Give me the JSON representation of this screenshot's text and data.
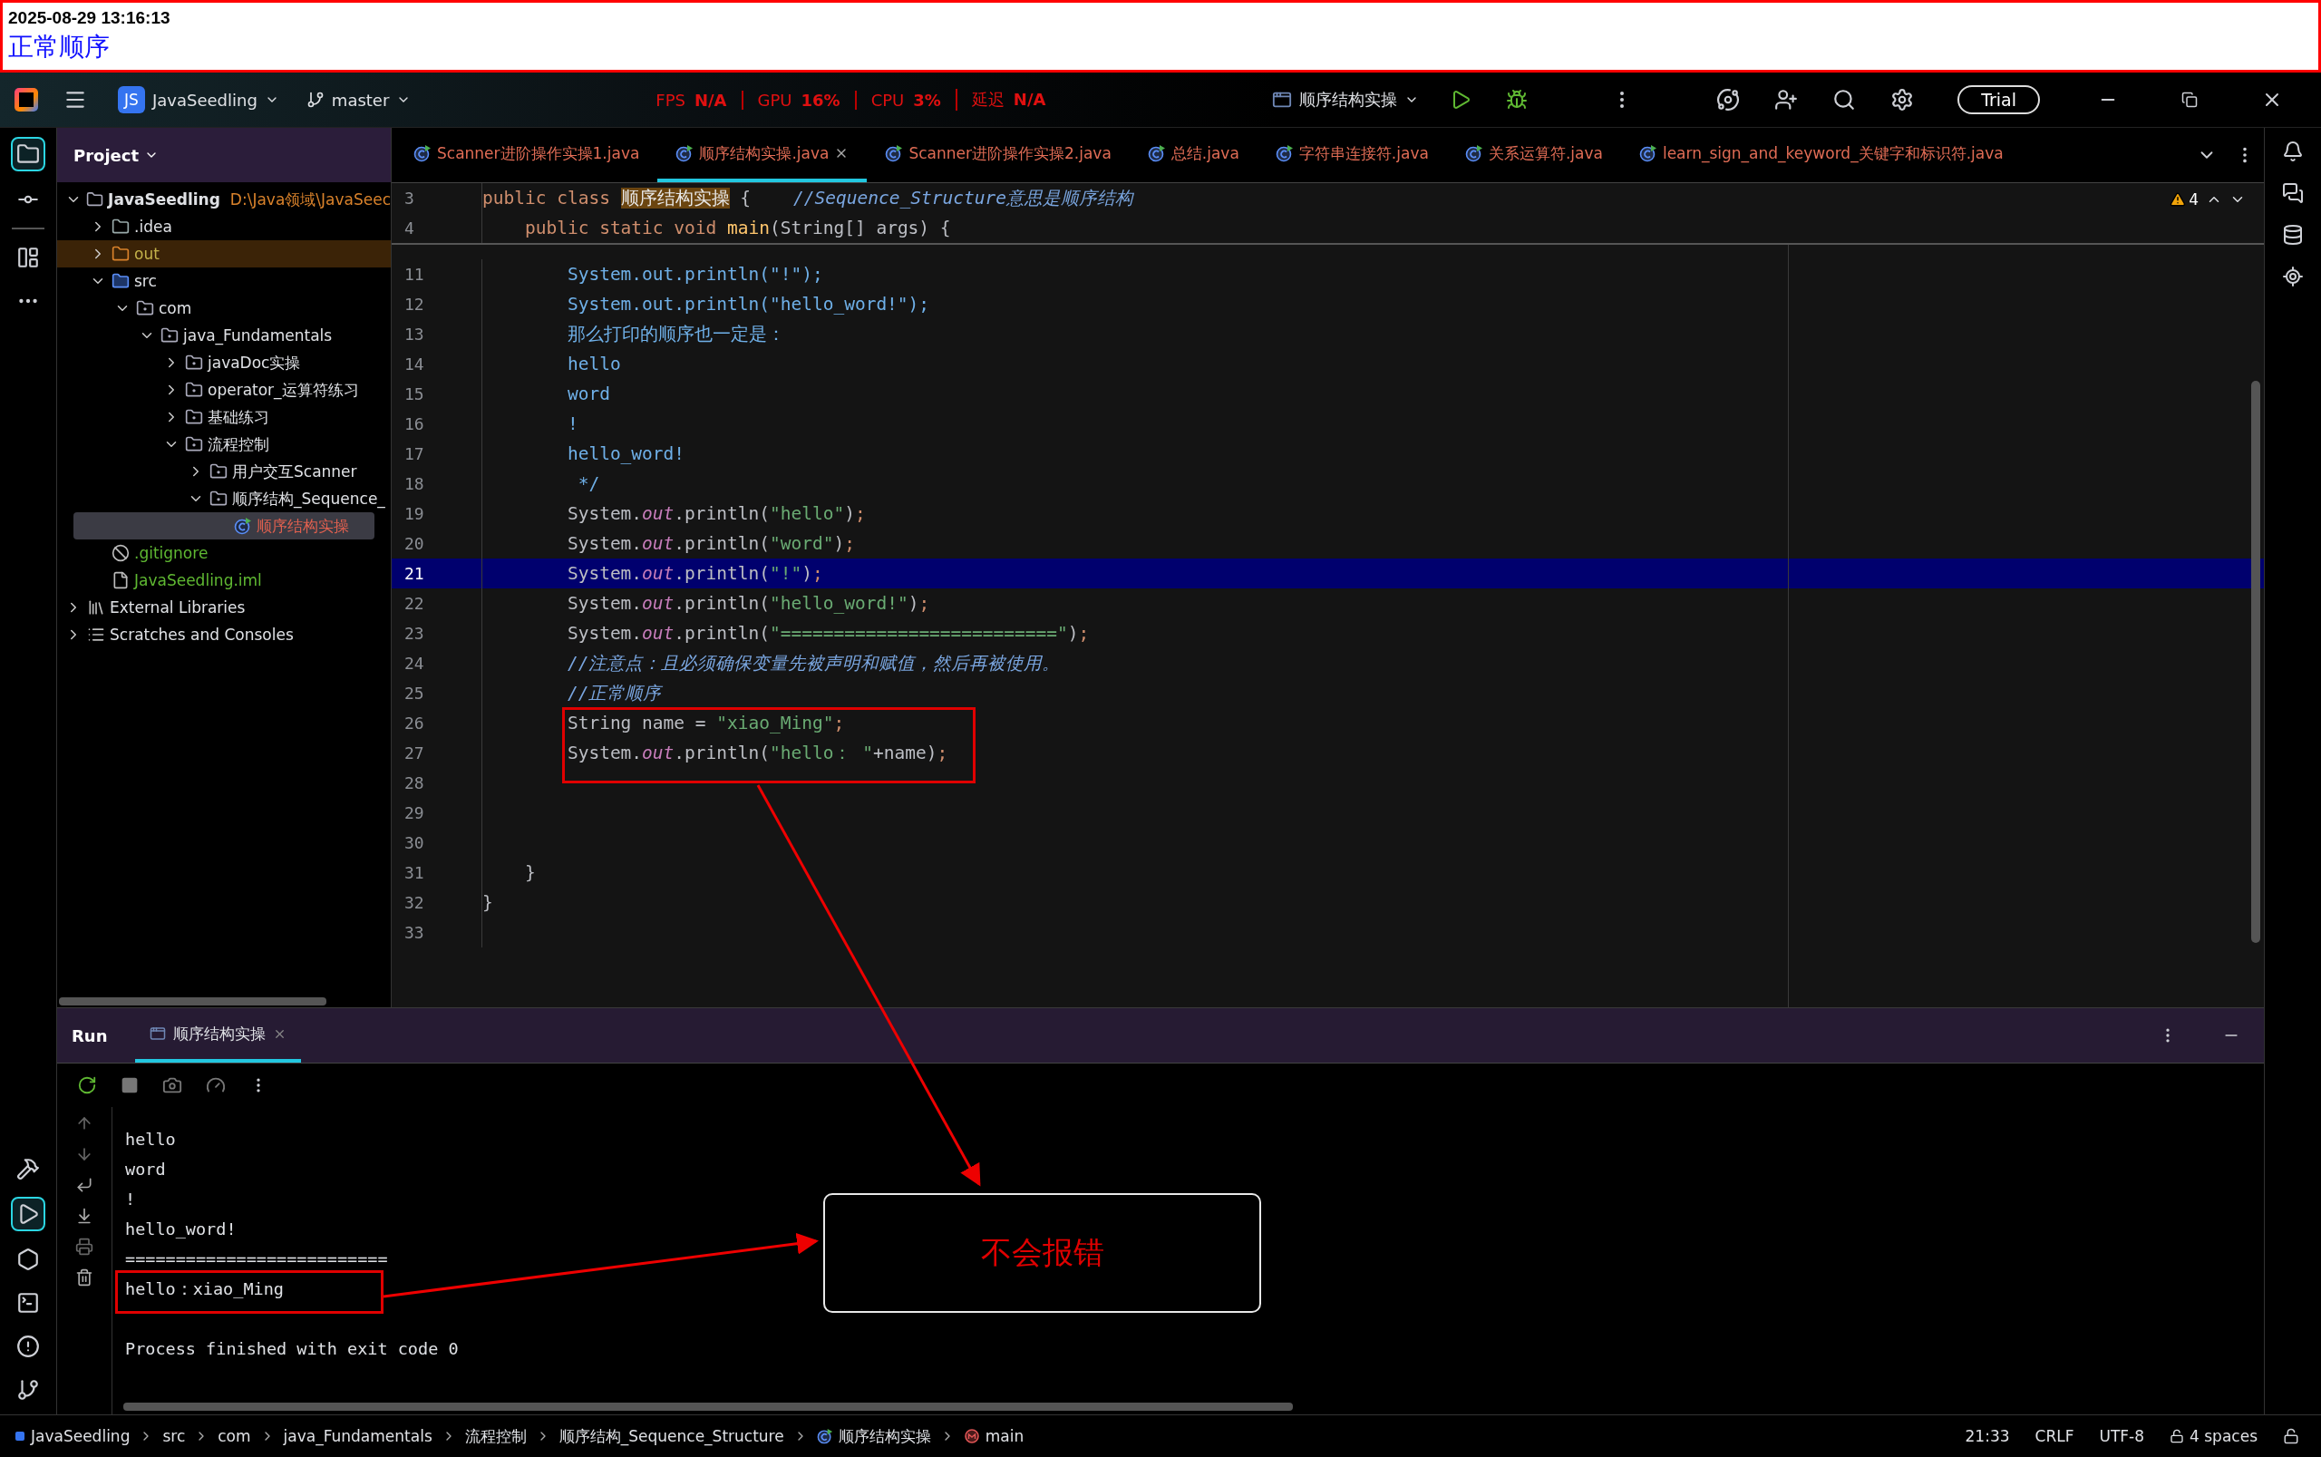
{
  "banner": {
    "timestamp": "2025-08-29 13:16:13",
    "title": "正常顺序"
  },
  "titlebar": {
    "project_badge": "JS",
    "project": "JavaSeedling",
    "branch": "master",
    "metrics": [
      {
        "label": "FPS",
        "value": "N/A"
      },
      {
        "label": "GPU",
        "value": "16%"
      },
      {
        "label": "CPU",
        "value": "3%"
      },
      {
        "label": "延迟",
        "value": "N/A"
      }
    ],
    "run_config": "顺序结构实操",
    "trial": "Trial"
  },
  "project_panel": {
    "title": "Project",
    "tree": [
      {
        "label": "JavaSeedling",
        "path": "D:\\Java领域\\JavaSeec",
        "kind": "module",
        "expanded": true,
        "selected": false,
        "children": [
          {
            "label": ".idea",
            "kind": "folder",
            "expanded": false,
            "selected": false
          },
          {
            "label": "out",
            "kind": "excluded",
            "expanded": false,
            "selected": false
          },
          {
            "label": "src",
            "kind": "source",
            "expanded": true,
            "selected": false,
            "children": [
              {
                "label": "com",
                "kind": "package",
                "expanded": true,
                "selected": false,
                "children": [
                  {
                    "label": "java_Fundamentals",
                    "kind": "package",
                    "expanded": true,
                    "selected": false,
                    "children": [
                      {
                        "label": "javaDoc实操",
                        "kind": "package",
                        "expanded": false,
                        "selected": false
                      },
                      {
                        "label": "operator_运算符练习",
                        "kind": "package",
                        "expanded": false,
                        "selected": false
                      },
                      {
                        "label": "基础练习",
                        "kind": "package",
                        "expanded": false,
                        "selected": false
                      },
                      {
                        "label": "流程控制",
                        "kind": "package",
                        "expanded": true,
                        "selected": false,
                        "children": [
                          {
                            "label": "用户交互Scanner",
                            "kind": "package",
                            "expanded": false,
                            "selected": false
                          },
                          {
                            "label": "顺序结构_Sequence_",
                            "kind": "package",
                            "expanded": true,
                            "selected": false,
                            "children": [
                              {
                                "label": "顺序结构实操",
                                "kind": "class",
                                "selected": true
                              }
                            ]
                          }
                        ]
                      }
                    ]
                  }
                ]
              }
            ]
          },
          {
            "label": ".gitignore",
            "kind": "ignore",
            "selected": false
          },
          {
            "label": "JavaSeedling.iml",
            "kind": "iml",
            "selected": false
          }
        ]
      },
      {
        "label": "External Libraries",
        "kind": "libraries",
        "expanded": false,
        "selected": false
      },
      {
        "label": "Scratches and Consoles",
        "kind": "scratches",
        "expanded": false,
        "selected": false
      }
    ]
  },
  "editor": {
    "tabs": [
      {
        "label": "Scanner进阶操作实操1.java",
        "selected": false
      },
      {
        "label": "顺序结构实操.java",
        "selected": true
      },
      {
        "label": "Scanner进阶操作实操2.java",
        "selected": false
      },
      {
        "label": "总结.java",
        "selected": false
      },
      {
        "label": "字符串连接符.java",
        "selected": false
      },
      {
        "label": "关系运算符.java",
        "selected": false
      },
      {
        "label": "learn_sign_and_keyword_关键字和标识符.java",
        "selected": false
      }
    ],
    "warnings": "4",
    "sticky_lines": [
      {
        "number": "3",
        "tokens": [
          {
            "kind": "keyword",
            "text": "public class "
          },
          {
            "kind": "classname",
            "text": "顺序结构实操"
          },
          {
            "kind": "plain",
            "text": " {    "
          },
          {
            "kind": "comment",
            "text": "//Sequence_Structure意思是顺序结构"
          }
        ]
      },
      {
        "number": "4",
        "tokens": [
          {
            "kind": "keyword",
            "text": "    public static void "
          },
          {
            "kind": "method",
            "text": "main"
          },
          {
            "kind": "plain",
            "text": "(String[] args) {"
          }
        ]
      }
    ],
    "lines": [
      {
        "number": "11",
        "current": false,
        "tokens": [
          {
            "kind": "doc",
            "text": "        System.out.println(\"!\");"
          }
        ]
      },
      {
        "number": "12",
        "current": false,
        "tokens": [
          {
            "kind": "doc",
            "text": "        System.out.println(\"hello_word!\");"
          }
        ]
      },
      {
        "number": "13",
        "current": false,
        "tokens": [
          {
            "kind": "doc",
            "text": "        那么打印的顺序也一定是："
          }
        ]
      },
      {
        "number": "14",
        "current": false,
        "tokens": [
          {
            "kind": "doc",
            "text": "        hello"
          }
        ]
      },
      {
        "number": "15",
        "current": false,
        "tokens": [
          {
            "kind": "doc",
            "text": "        word"
          }
        ]
      },
      {
        "number": "16",
        "current": false,
        "tokens": [
          {
            "kind": "doc",
            "text": "        !"
          }
        ]
      },
      {
        "number": "17",
        "current": false,
        "tokens": [
          {
            "kind": "doc",
            "text": "        hello_word!"
          }
        ]
      },
      {
        "number": "18",
        "current": false,
        "tokens": [
          {
            "kind": "doc",
            "text": "         */"
          }
        ]
      },
      {
        "number": "19",
        "current": false,
        "tokens": [
          {
            "kind": "plain",
            "text": "        System."
          },
          {
            "kind": "field",
            "text": "out"
          },
          {
            "kind": "plain",
            "text": ".println("
          },
          {
            "kind": "string",
            "text": "\"hello\""
          },
          {
            "kind": "plain",
            "text": ")"
          },
          {
            "kind": "semi",
            "text": ";"
          }
        ]
      },
      {
        "number": "20",
        "current": false,
        "tokens": [
          {
            "kind": "plain",
            "text": "        System."
          },
          {
            "kind": "field",
            "text": "out"
          },
          {
            "kind": "plain",
            "text": ".println("
          },
          {
            "kind": "string",
            "text": "\"word\""
          },
          {
            "kind": "plain",
            "text": ")"
          },
          {
            "kind": "semi",
            "text": ";"
          }
        ]
      },
      {
        "number": "21",
        "current": true,
        "tokens": [
          {
            "kind": "plain",
            "text": "        System."
          },
          {
            "kind": "field",
            "text": "out"
          },
          {
            "kind": "plain",
            "text": ".println("
          },
          {
            "kind": "string",
            "text": "\"!\""
          },
          {
            "kind": "plain",
            "text": ")"
          },
          {
            "kind": "semi",
            "text": ";"
          }
        ]
      },
      {
        "number": "22",
        "current": false,
        "tokens": [
          {
            "kind": "plain",
            "text": "        System."
          },
          {
            "kind": "field",
            "text": "out"
          },
          {
            "kind": "plain",
            "text": ".println("
          },
          {
            "kind": "string",
            "text": "\"hello_word!\""
          },
          {
            "kind": "plain",
            "text": ")"
          },
          {
            "kind": "semi",
            "text": ";"
          }
        ]
      },
      {
        "number": "23",
        "current": false,
        "tokens": [
          {
            "kind": "plain",
            "text": "        System."
          },
          {
            "kind": "field",
            "text": "out"
          },
          {
            "kind": "plain",
            "text": ".println("
          },
          {
            "kind": "string",
            "text": "\"==========================\""
          },
          {
            "kind": "plain",
            "text": ")"
          },
          {
            "kind": "semi",
            "text": ";"
          }
        ]
      },
      {
        "number": "24",
        "current": false,
        "tokens": [
          {
            "kind": "comment",
            "text": "        //注意点：且必须确保变量先被声明和赋值，然后再被使用。"
          }
        ]
      },
      {
        "number": "25",
        "current": false,
        "tokens": [
          {
            "kind": "comment",
            "text": "        //正常顺序"
          }
        ]
      },
      {
        "number": "26",
        "current": false,
        "tokens": [
          {
            "kind": "plain",
            "text": "        String name = "
          },
          {
            "kind": "string",
            "text": "\"xiao_Ming\""
          },
          {
            "kind": "semi",
            "text": ";"
          }
        ]
      },
      {
        "number": "27",
        "current": false,
        "tokens": [
          {
            "kind": "plain",
            "text": "        System."
          },
          {
            "kind": "field",
            "text": "out"
          },
          {
            "kind": "plain",
            "text": ".println("
          },
          {
            "kind": "string",
            "text": "\"hello： \""
          },
          {
            "kind": "plain",
            "text": "+name)"
          },
          {
            "kind": "semi",
            "text": ";"
          }
        ]
      },
      {
        "number": "28",
        "current": false
      },
      {
        "number": "29",
        "current": false
      },
      {
        "number": "30",
        "current": false
      },
      {
        "number": "31",
        "current": false,
        "tokens": [
          {
            "kind": "plain",
            "text": "    }"
          }
        ]
      },
      {
        "number": "32",
        "current": false,
        "tokens": [
          {
            "kind": "plain",
            "text": "}"
          }
        ]
      },
      {
        "number": "33",
        "current": false
      }
    ]
  },
  "run_panel": {
    "title": "Run",
    "tab": {
      "label": "顺序结构实操",
      "selected": true
    },
    "console": [
      "hello",
      "word",
      "!",
      "hello_word!",
      "==========================",
      "hello：xiao_Ming"
    ],
    "exit_message": "Process finished with exit code 0"
  },
  "annotations": {
    "callout": "不会报错"
  },
  "status_bar": {
    "breadcrumbs": [
      {
        "label": "JavaSeedling",
        "kind": "module"
      },
      {
        "label": "src",
        "kind": "dir"
      },
      {
        "label": "com",
        "kind": "dir"
      },
      {
        "label": "java_Fundamentals",
        "kind": "dir"
      },
      {
        "label": "流程控制",
        "kind": "dir"
      },
      {
        "label": "顺序结构_Sequence_Structure",
        "kind": "dir"
      },
      {
        "label": "顺序结构实操",
        "kind": "class"
      },
      {
        "label": "main",
        "kind": "method"
      }
    ],
    "position": "21:33",
    "line_separator": "CRLF",
    "encoding": "UTF-8",
    "indent": "4 spaces"
  }
}
